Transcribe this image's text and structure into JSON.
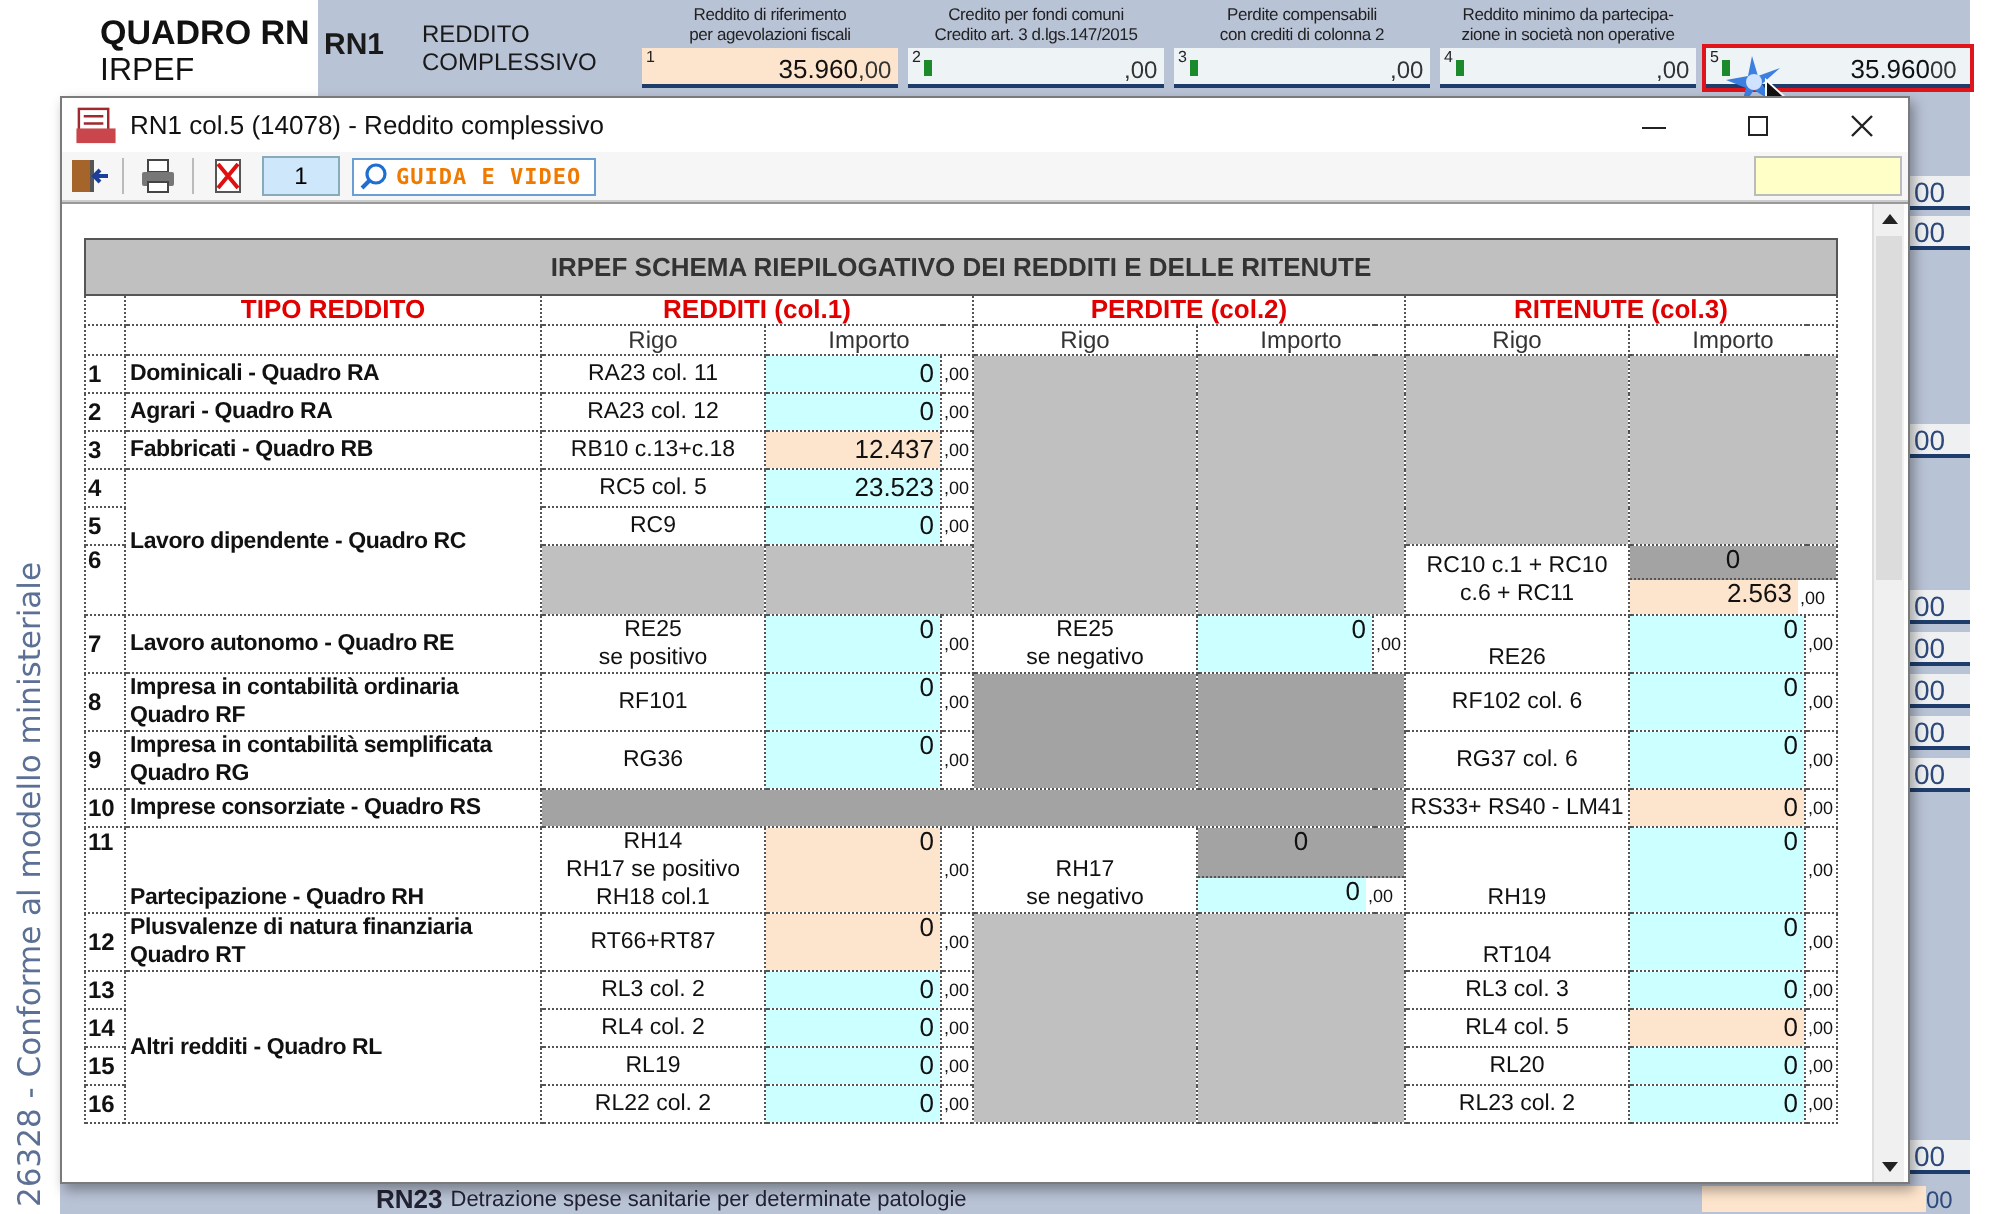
{
  "form": {
    "title": "QUADRO RN",
    "subtitle": "IRPEF",
    "note": "26328 - Conforme al modello ministeriale",
    "line": {
      "code": "RN1",
      "label": [
        "REDDITO",
        "COMPLESSIVO"
      ],
      "fields": [
        {
          "number": "1",
          "caption": [
            "Reddito di riferimento",
            "per agevolazioni fiscali"
          ],
          "value": "35.960",
          "decimals": ",00",
          "color": "#fde4cc",
          "marker": false,
          "selected": false
        },
        {
          "number": "2",
          "caption": [
            "Credito per fondi comuni",
            "Credito art. 3 d.lgs.147/2015"
          ],
          "decimals": ",00",
          "color": "#eef4f6",
          "marker": true,
          "selected": false
        },
        {
          "number": "3",
          "caption": [
            "Perdite compensabili",
            "con crediti di colonna 2"
          ],
          "decimals": ",00",
          "color": "#eef4f6",
          "marker": true,
          "selected": false
        },
        {
          "number": "4",
          "caption": [
            "Reddito minimo da partecipa-",
            "zione in società non operative"
          ],
          "decimals": ",00",
          "color": "#eef4f6",
          "marker": true,
          "selected": false
        },
        {
          "number": "5",
          "value": "35.960",
          "decimals": "00",
          "color": "#eef4f6",
          "marker": true,
          "selected": true
        }
      ]
    },
    "side_fields": [
      {
        "decimals": "00"
      },
      {
        "decimals": "00"
      },
      {
        "decimals": "00"
      },
      {
        "decimals": "00"
      },
      {
        "decimals": "00"
      },
      {
        "decimals": "00"
      },
      {
        "decimals": "00"
      },
      {
        "decimals": "00"
      },
      {
        "decimals": "00"
      }
    ],
    "bottom_line": {
      "code": "RN23",
      "label": "Detrazione spese sanitarie per determinate patologie",
      "decimals": "00"
    }
  },
  "dialog": {
    "title": "RN1 col.5 (14078) - Reddito complessivo",
    "page": "1",
    "help_button": "GUIDA E VIDEO",
    "table": {
      "title": "IRPEF SCHEMA RIEPILOGATIVO DEI REDDITI E DELLE RITENUTE",
      "type_heading": "TIPO REDDITO",
      "groups": [
        "REDDITI (col.1)",
        "PERDITE (col.2)",
        "RITENUTE (col.3)"
      ],
      "subheads": [
        "Rigo",
        "Importo",
        "Rigo",
        "Importo",
        "Rigo",
        "Importo"
      ],
      "rows": [
        {
          "cells": [
            {
              "kind": "num",
              "text": "1"
            },
            {
              "kind": "label",
              "lines": [
                "Dominicali - Quadro RA"
              ]
            },
            {
              "kind": "rigo",
              "lines": [
                "RA23 col. 11"
              ]
            },
            {
              "kind": "amount",
              "color": "#ccffff",
              "value": "0"
            },
            {
              "kind": "decimals",
              "text": ",00"
            },
            {
              "kind": "blank",
              "color": "#c0c0c0",
              "rowspan": 6
            },
            {
              "kind": "blank",
              "color": "#c0c0c0",
              "rowspan": 6,
              "colspan": 2
            },
            {
              "kind": "blank",
              "color": "#c0c0c0",
              "rowspan": 5
            },
            {
              "kind": "blank",
              "color": "#c0c0c0",
              "rowspan": 5,
              "colspan": 2
            }
          ]
        },
        {
          "cells": [
            {
              "kind": "num",
              "text": "2"
            },
            {
              "kind": "label",
              "lines": [
                "Agrari - Quadro RA"
              ]
            },
            {
              "kind": "rigo",
              "lines": [
                "RA23 col. 12"
              ]
            },
            {
              "kind": "amount",
              "color": "#ccffff",
              "value": "0"
            },
            {
              "kind": "decimals",
              "text": ",00"
            }
          ]
        },
        {
          "cells": [
            {
              "kind": "num",
              "text": "3"
            },
            {
              "kind": "label",
              "lines": [
                "Fabbricati - Quadro RB"
              ]
            },
            {
              "kind": "rigo",
              "lines": [
                "RB10 c.13+c.18"
              ]
            },
            {
              "kind": "amount",
              "color": "#fde4cc",
              "value": "12.437"
            },
            {
              "kind": "decimals",
              "text": ",00"
            }
          ]
        },
        {
          "cells": [
            {
              "kind": "num",
              "text": "4"
            },
            {
              "kind": "label",
              "lines": [
                "Lavoro dipendente - Quadro RC"
              ],
              "rowspan": 3
            },
            {
              "kind": "rigo",
              "lines": [
                "RC5 col. 5"
              ]
            },
            {
              "kind": "amount",
              "color": "#ccffff",
              "value": "23.523"
            },
            {
              "kind": "decimals",
              "text": ",00"
            }
          ]
        },
        {
          "cells": [
            {
              "kind": "num",
              "text": "5"
            },
            {
              "kind": "rigo",
              "lines": [
                "RC9"
              ]
            },
            {
              "kind": "amount",
              "color": "#ccffff",
              "value": "0"
            },
            {
              "kind": "decimals",
              "text": ",00"
            }
          ]
        },
        {
          "cells": [
            {
              "kind": "num_top",
              "text": "6"
            },
            {
              "kind": "blank",
              "color": "#c0c0c0"
            },
            {
              "kind": "blank",
              "color": "#c0c0c0",
              "colspan": 2
            },
            {
              "kind": "rigo",
              "lines": [
                "RC10 c.1 + RC10",
                "c.6 + RC11"
              ]
            },
            {
              "kind": "split",
              "colspan": 2,
              "top": {
                "color": "#a3a3a3",
                "value": "0"
              },
              "bottom": {
                "color": "#fde4cc",
                "value": "2.563",
                "decimals": ",00"
              }
            }
          ]
        },
        {
          "cells": [
            {
              "kind": "num",
              "text": "7"
            },
            {
              "kind": "label",
              "lines": [
                "Lavoro autonomo - Quadro RE"
              ]
            },
            {
              "kind": "rigo",
              "lines": [
                "RE25",
                "se positivo"
              ]
            },
            {
              "kind": "amount_top",
              "color": "#ccffff",
              "value": "0"
            },
            {
              "kind": "decimals",
              "text": ",00"
            },
            {
              "kind": "rigo",
              "lines": [
                "RE25",
                "se negativo"
              ]
            },
            {
              "kind": "amount_top",
              "color": "#ccffff",
              "value": "0"
            },
            {
              "kind": "decimals",
              "text": ",00"
            },
            {
              "kind": "rigo_low",
              "lines": [
                "RE26"
              ]
            },
            {
              "kind": "amount_top",
              "color": "#ccffff",
              "value": "0"
            },
            {
              "kind": "decimals",
              "text": ",00"
            }
          ]
        },
        {
          "cells": [
            {
              "kind": "num",
              "text": "8"
            },
            {
              "kind": "label",
              "lines": [
                "Impresa in contabilità ordinaria",
                "Quadro RF"
              ]
            },
            {
              "kind": "rigo",
              "lines": [
                "RF101"
              ]
            },
            {
              "kind": "amount_top",
              "color": "#ccffff",
              "value": "0"
            },
            {
              "kind": "decimals",
              "text": ",00"
            },
            {
              "kind": "blank",
              "color": "#a3a3a3",
              "rowspan": 2
            },
            {
              "kind": "blank",
              "color": "#a3a3a3",
              "rowspan": 2,
              "colspan": 2
            },
            {
              "kind": "rigo",
              "lines": [
                "RF102 col. 6"
              ]
            },
            {
              "kind": "amount_top",
              "color": "#ccffff",
              "value": "0"
            },
            {
              "kind": "decimals",
              "text": ",00"
            }
          ]
        },
        {
          "cells": [
            {
              "kind": "num",
              "text": "9"
            },
            {
              "kind": "label",
              "lines": [
                "Impresa in contabilità semplificata",
                "Quadro RG"
              ]
            },
            {
              "kind": "rigo",
              "lines": [
                "RG36"
              ]
            },
            {
              "kind": "amount_top",
              "color": "#ccffff",
              "value": "0"
            },
            {
              "kind": "decimals",
              "text": ",00"
            },
            {
              "kind": "rigo",
              "lines": [
                "RG37 col. 6"
              ]
            },
            {
              "kind": "amount_top",
              "color": "#ccffff",
              "value": "0"
            },
            {
              "kind": "decimals",
              "text": ",00"
            }
          ]
        },
        {
          "cells": [
            {
              "kind": "num",
              "text": "10"
            },
            {
              "kind": "label",
              "lines": [
                "Imprese consorziate - Quadro RS"
              ]
            },
            {
              "kind": "blank",
              "color": "#a3a3a3",
              "colspan": 6
            },
            {
              "kind": "rigo",
              "lines": [
                "RS33+ RS40 - LM41"
              ]
            },
            {
              "kind": "amount",
              "color": "#fde4cc",
              "value": "0"
            },
            {
              "kind": "decimals",
              "text": ",00"
            }
          ]
        },
        {
          "cells": [
            {
              "kind": "num_top",
              "text": "11"
            },
            {
              "kind": "label_low",
              "lines": [
                "Partecipazione - Quadro RH"
              ]
            },
            {
              "kind": "rigo",
              "lines": [
                "RH14",
                "RH17 se positivo",
                "RH18 col.1"
              ]
            },
            {
              "kind": "amount_top",
              "color": "#fde4cc",
              "value": "0"
            },
            {
              "kind": "decimals",
              "text": ",00"
            },
            {
              "kind": "rigo_low",
              "lines": [
                "RH17",
                "se negativo"
              ]
            },
            {
              "kind": "split",
              "colspan": 2,
              "top": {
                "color": "#a3a3a3",
                "value": "0"
              },
              "bottom": {
                "color": "#ccffff",
                "value": "0",
                "decimals": ",00"
              }
            },
            {
              "kind": "rigo_low",
              "lines": [
                "RH19"
              ]
            },
            {
              "kind": "amount_top",
              "color": "#ccffff",
              "value": "0"
            },
            {
              "kind": "decimals",
              "text": ",00"
            }
          ]
        },
        {
          "cells": [
            {
              "kind": "num",
              "text": "12"
            },
            {
              "kind": "label",
              "lines": [
                "Plusvalenze di natura finanziaria",
                "Quadro RT"
              ]
            },
            {
              "kind": "rigo",
              "lines": [
                "RT66+RT87"
              ]
            },
            {
              "kind": "amount_top",
              "color": "#fde4cc",
              "value": "0"
            },
            {
              "kind": "decimals",
              "text": ",00"
            },
            {
              "kind": "blank",
              "color": "#c0c0c0",
              "rowspan": 5
            },
            {
              "kind": "blank",
              "color": "#c0c0c0",
              "rowspan": 5,
              "colspan": 2
            },
            {
              "kind": "rigo_low",
              "lines": [
                "RT104"
              ]
            },
            {
              "kind": "amount_top",
              "color": "#ccffff",
              "value": "0"
            },
            {
              "kind": "decimals",
              "text": ",00"
            }
          ]
        },
        {
          "cells": [
            {
              "kind": "num",
              "text": "13"
            },
            {
              "kind": "label",
              "lines": [
                "Altri redditi - Quadro RL"
              ],
              "rowspan": 4
            },
            {
              "kind": "rigo",
              "lines": [
                "RL3 col. 2"
              ]
            },
            {
              "kind": "amount",
              "color": "#ccffff",
              "value": "0"
            },
            {
              "kind": "decimals",
              "text": ",00"
            },
            {
              "kind": "rigo",
              "lines": [
                "RL3 col. 3"
              ]
            },
            {
              "kind": "amount",
              "color": "#ccffff",
              "value": "0"
            },
            {
              "kind": "decimals",
              "text": ",00"
            }
          ]
        },
        {
          "cells": [
            {
              "kind": "num",
              "text": "14"
            },
            {
              "kind": "rigo",
              "lines": [
                "RL4 col. 2"
              ]
            },
            {
              "kind": "amount",
              "color": "#ccffff",
              "value": "0"
            },
            {
              "kind": "decimals",
              "text": ",00"
            },
            {
              "kind": "rigo",
              "lines": [
                "RL4 col. 5"
              ]
            },
            {
              "kind": "amount",
              "color": "#fde4cc",
              "value": "0"
            },
            {
              "kind": "decimals",
              "text": ",00"
            }
          ]
        },
        {
          "cells": [
            {
              "kind": "num",
              "text": "15"
            },
            {
              "kind": "rigo",
              "lines": [
                "RL19"
              ]
            },
            {
              "kind": "amount",
              "color": "#ccffff",
              "value": "0"
            },
            {
              "kind": "decimals",
              "text": ",00"
            },
            {
              "kind": "rigo",
              "lines": [
                "RL20"
              ]
            },
            {
              "kind": "amount",
              "color": "#ccffff",
              "value": "0"
            },
            {
              "kind": "decimals",
              "text": ",00"
            }
          ]
        },
        {
          "cells": [
            {
              "kind": "num",
              "text": "16"
            },
            {
              "kind": "rigo",
              "lines": [
                "RL22 col. 2"
              ]
            },
            {
              "kind": "amount",
              "color": "#ccffff",
              "value": "0"
            },
            {
              "kind": "decimals",
              "text": ",00"
            },
            {
              "kind": "rigo",
              "lines": [
                "RL23 col. 2"
              ]
            },
            {
              "kind": "amount",
              "color": "#ccffff",
              "value": "0"
            },
            {
              "kind": "decimals",
              "text": ",00"
            }
          ]
        }
      ]
    }
  }
}
